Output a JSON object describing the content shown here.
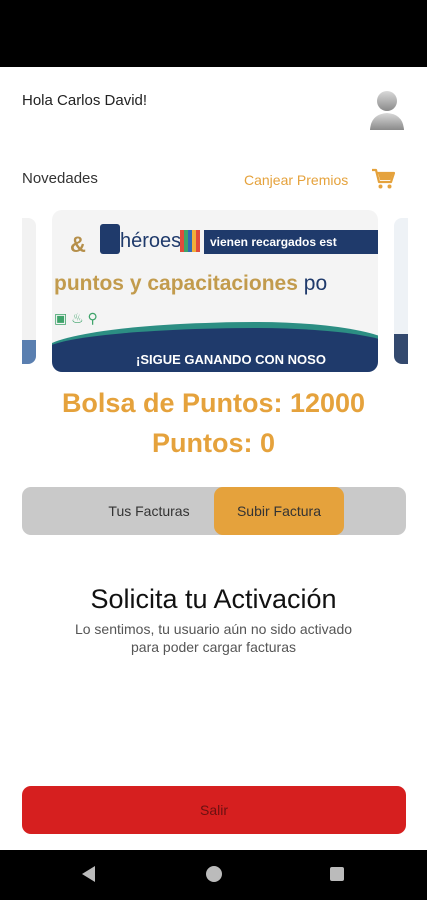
{
  "header": {
    "greeting": "Hola Carlos David!",
    "avatar_icon": "user-avatar-icon"
  },
  "news": {
    "label": "Novedades",
    "redeem_label": "Canjear Premios",
    "cart_icon": "shopping-cart-icon"
  },
  "banner": {
    "amp": "&",
    "logo_text": "héroes",
    "tagline": "vienen recargados est",
    "headline": "puntos y capacitaciones",
    "headline_tail": "po",
    "cta": "¡SIGUE GANANDO CON NOSO"
  },
  "points": {
    "bag": "Bolsa de Puntos: 12000",
    "current": "Puntos: 0"
  },
  "tabs": {
    "invoices": "Tus Facturas",
    "upload": "Subir Factura"
  },
  "activation": {
    "title": "Solicita tu Activación",
    "line1": "Lo sentimos, tu usuario aún no sido activado",
    "line2": "para poder cargar facturas"
  },
  "footer": {
    "exit": "Salir"
  },
  "colors": {
    "accent": "#e5a23c",
    "danger": "#d61f1f",
    "tab_bg": "#c9c9c9",
    "brand_navy": "#1f3a6b"
  }
}
